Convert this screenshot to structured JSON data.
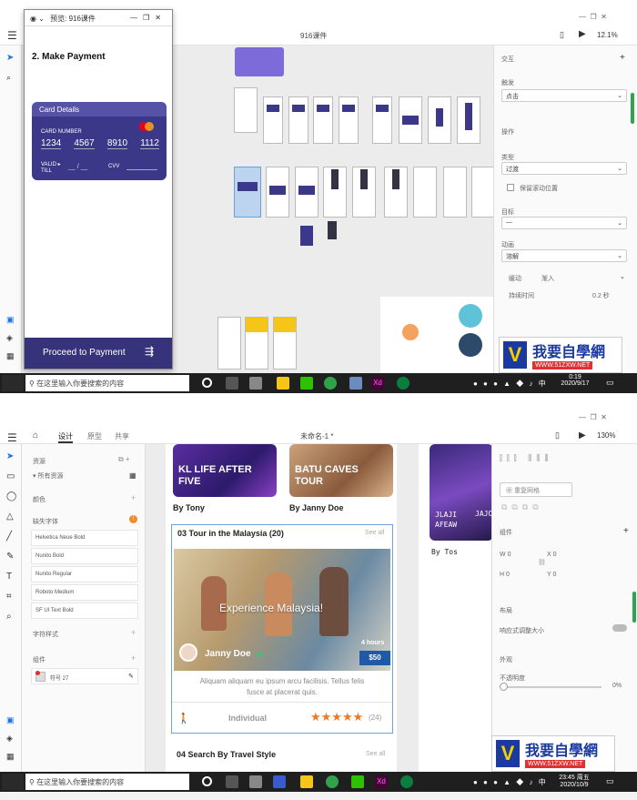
{
  "top": {
    "window_title": "预览: 916课件",
    "doc_title": "916课件",
    "zoom": "12.1%",
    "page_heading": "2. Make Payment",
    "card": {
      "header": "Card Details",
      "number_label": "CARD NUMBER",
      "number_groups": [
        "1234",
        "4567",
        "8910",
        "1112"
      ],
      "valid_label_1": "VALID",
      "valid_label_2": "TILL",
      "valid_placeholder": "__ / __",
      "cvv_label": "CVV"
    },
    "cta": "Proceed to Payment",
    "right_panel": {
      "section_interaction": "交互",
      "trigger_label": "触发",
      "trigger_value": "点击",
      "action_label": "操作",
      "type_label": "类型",
      "type_value": "过渡",
      "keep_scroll": "保留滚动位置",
      "target_label": "目标",
      "target_value": "—",
      "animation_label": "动画",
      "animation_value": "溶解",
      "easing_label": "缓动",
      "easing_value": "渐入",
      "duration_label": "持续时间",
      "duration_value": "0.2 秒"
    },
    "search_placeholder": "在这里输入你要搜索的内容",
    "clock_time": "0:19",
    "clock_date": "2020/9/17"
  },
  "bottom": {
    "tabs": [
      "设计",
      "原型",
      "共享"
    ],
    "doc_title": "未命名-1 *",
    "zoom": "130%",
    "assets_title": "资源",
    "assets_filter": "所有资源",
    "colors_label": "颜色",
    "char_styles_label": "缺失字体",
    "fonts": [
      "Helvetica Neue Bold",
      "Nunito Bold",
      "Nunito Regular",
      "Roboto Medium",
      "SF UI Text Bold"
    ],
    "text_styles_label": "字符样式",
    "components_label": "组件",
    "symbol_label": "符号 27",
    "cards": [
      {
        "title_line1": "KL LIFE AFTER",
        "title_line2": "FIVE",
        "by": "By Tony"
      },
      {
        "title_line1": "BATU CAVES",
        "title_line2": "TOUR",
        "by": "By Janny Doe"
      }
    ],
    "section3_title": "03 Tour in the Malaysia (20)",
    "see_all": "See all",
    "hero_text": "Experience Malaysia!",
    "hero_name": "Janny Doe",
    "hero_duration": "4 hours",
    "hero_price": "$50",
    "description_line1": "Aliquam aliquam eu ipsum arcu facilisis. Tellus felis",
    "description_line2": "fusce at placerat quis.",
    "tour_type": "Individual",
    "stars": "★★★★★",
    "review_count": "(24)",
    "section4_title": "04 Search By Travel Style",
    "side_card_line1": "JLAJI",
    "side_card_line2": "AFEAW",
    "side_card_line3": "JAJO",
    "side_by": "By Tos",
    "right_panel": {
      "repeat_grid": "重复网格",
      "components": "组件",
      "w_label": "W",
      "w_value": "0",
      "h_label": "H",
      "h_value": "0",
      "x_label": "X",
      "x_value": "0",
      "y_label": "Y",
      "y_value": "0",
      "layout": "布局",
      "responsive": "响应式调整大小",
      "appearance": "外观",
      "opacity": "不透明度",
      "opacity_value": "0%"
    },
    "search_placeholder": "在这里输入你要搜索的内容",
    "clock_time": "23:45 周五",
    "clock_date": "2020/10/9"
  },
  "watermark": {
    "text": "我要自學網",
    "url": "WWW.51ZXW.NET"
  },
  "colors": {
    "card_purple": "#3b3889",
    "cta_purple": "#36337a",
    "accent_orange": "#ea7a26",
    "price_blue": "#1e5aa8",
    "xd_pink": "#ff26be"
  }
}
